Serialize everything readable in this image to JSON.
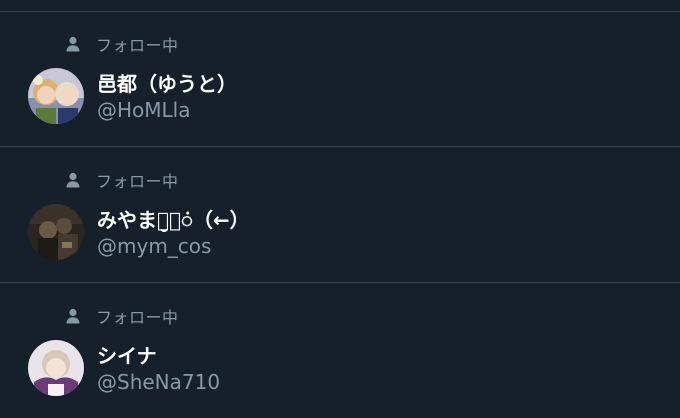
{
  "list": {
    "items": [
      {
        "context_label": "フォロー中",
        "display_name": "邑都（ゆうと）",
        "handle": "@HoMLla",
        "avatar_icon": "user-avatar-photo"
      },
      {
        "context_label": "フォロー中",
        "display_name": "みやまం̮ంं（←）",
        "handle": "@mym_cos",
        "avatar_icon": "user-avatar-photo"
      },
      {
        "context_label": "フォロー中",
        "display_name": "シイナ",
        "handle": "@SheNa710",
        "avatar_icon": "user-avatar-photo"
      }
    ]
  },
  "colors": {
    "background": "#15202b",
    "divider": "#38444d",
    "secondary_text": "#8899a6",
    "primary_text": "#ffffff"
  }
}
